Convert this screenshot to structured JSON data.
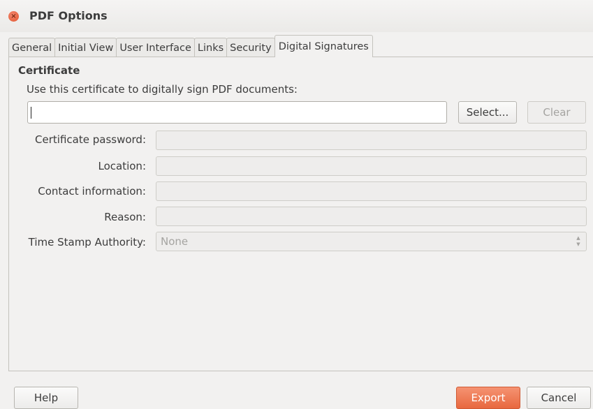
{
  "window": {
    "title": "PDF Options",
    "close_glyph": "×",
    "close_icon": "close-icon"
  },
  "tabs": [
    {
      "label": "General",
      "active": false
    },
    {
      "label": "Initial View",
      "active": false
    },
    {
      "label": "User Interface",
      "active": false
    },
    {
      "label": "Links",
      "active": false
    },
    {
      "label": "Security",
      "active": false
    },
    {
      "label": "Digital Signatures",
      "active": true
    }
  ],
  "certificate": {
    "section_title": "Certificate",
    "description": "Use this certificate to digitally sign PDF documents:",
    "value": "",
    "select_label": "Select...",
    "clear_label": "Clear"
  },
  "fields": {
    "password_label": "Certificate password:",
    "password_value": "",
    "location_label": "Location:",
    "location_value": "",
    "contact_label": "Contact information:",
    "contact_value": "",
    "reason_label": "Reason:",
    "reason_value": "",
    "tsa_label": "Time Stamp Authority:",
    "tsa_value": "None"
  },
  "footer": {
    "help_label": "Help",
    "export_label": "Export",
    "cancel_label": "Cancel"
  },
  "colors": {
    "accent": "#e8683f",
    "close": "#e2572f"
  }
}
